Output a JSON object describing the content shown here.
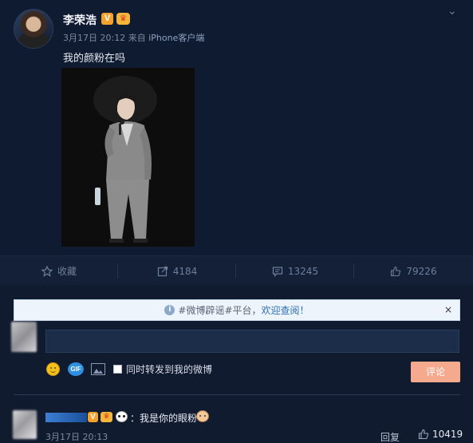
{
  "post": {
    "author": "李荣浩",
    "verified_badge": "V",
    "date": "3月17日 20:12",
    "source_prefix": "来自",
    "source": "iPhone客户端",
    "text": "我的颜粉在吗"
  },
  "actions": {
    "favorite_label": "收藏",
    "repost_count": "4184",
    "comment_count": "13245",
    "like_count": "79226"
  },
  "notice": {
    "text": "#微博辟谣#平台，",
    "link": "欢迎查阅！",
    "close": "×"
  },
  "composer": {
    "gif_label": "GIF",
    "repost_checkbox_label": "同时转发到我的微博",
    "submit_label": "评论"
  },
  "comment": {
    "verified_badge": "V",
    "text": "：我是你的眼粉",
    "time": "3月17日 20:13",
    "reply_label": "回复",
    "like_count": "10419"
  },
  "colors": {
    "background": "#0f1a2f",
    "accent_button": "#f5a98d",
    "link": "#2f6fb6",
    "badge_orange": "#f3a32b"
  }
}
